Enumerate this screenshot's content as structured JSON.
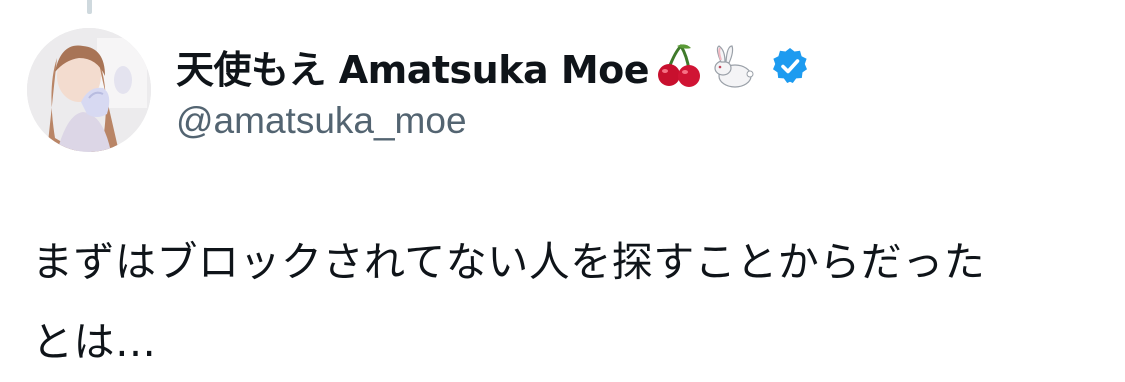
{
  "author": {
    "display_name": "天使もえ Amatsuka Moe",
    "handle": "@amatsuka_moe",
    "emojis": [
      "cherries-emoji",
      "rabbit-emoji"
    ],
    "verified": true,
    "verified_color": "#1d9bf0"
  },
  "tweet": {
    "lines": [
      "まずはブロックされてない人を探すことからだった",
      "とは…"
    ]
  },
  "colors": {
    "text": "#0f1419",
    "secondary_text": "#536471",
    "thread_line": "#cfd9de"
  }
}
